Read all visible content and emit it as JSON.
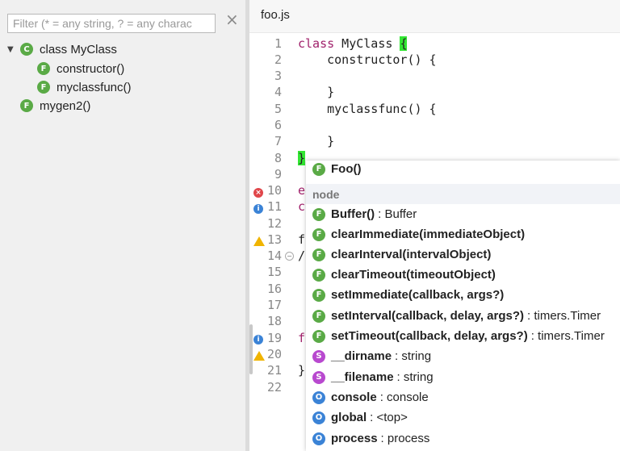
{
  "outline": {
    "filter_placeholder": "Filter (* = any string, ? = any charac",
    "clear_icon": "×",
    "tree": [
      {
        "badge": "C",
        "label": "class MyClass",
        "expanded": true
      },
      {
        "badge": "F",
        "label": "constructor()"
      },
      {
        "badge": "F",
        "label": "myclassfunc()"
      },
      {
        "badge": "F",
        "label": "mygen2()"
      }
    ]
  },
  "editor": {
    "tab": "foo.js",
    "line_numbers": [
      "1",
      "2",
      "3",
      "4",
      "5",
      "6",
      "7",
      "8",
      "9",
      "10",
      "11",
      "12",
      "13",
      "14",
      "15",
      "16",
      "17",
      "18",
      "19",
      "20",
      "21",
      "22"
    ],
    "code": {
      "l1_kw": "class",
      "l1_rest": " MyClass ",
      "l1_brace": "{",
      "l2": "    constructor() {",
      "l4": "    }",
      "l5": "    myclassfunc() {",
      "l7": "    }",
      "l8_brace": "}",
      "l10": "e",
      "l11": "c",
      "l13": "f",
      "l14": "/",
      "l19": "f",
      "l21": "}"
    }
  },
  "autocomplete": {
    "partial_item": {
      "badge": "F",
      "name": "Foo()"
    },
    "header": "node",
    "items": [
      {
        "badge": "F",
        "name": "Buffer()",
        "type": ": Buffer"
      },
      {
        "badge": "F",
        "name": "clearImmediate(immediateObject)",
        "type": ""
      },
      {
        "badge": "F",
        "name": "clearInterval(intervalObject)",
        "type": ""
      },
      {
        "badge": "F",
        "name": "clearTimeout(timeoutObject)",
        "type": ""
      },
      {
        "badge": "F",
        "name": "setImmediate(callback, args?)",
        "type": ""
      },
      {
        "badge": "F",
        "name": "setInterval(callback, delay, args?)",
        "type": ": timers.Timer"
      },
      {
        "badge": "F",
        "name": "setTimeout(callback, delay, args?)",
        "type": ": timers.Timer"
      },
      {
        "badge": "S",
        "name": "__dirname",
        "type": ": string"
      },
      {
        "badge": "S",
        "name": "__filename",
        "type": ": string"
      },
      {
        "badge": "O",
        "name": "console",
        "type": ": console"
      },
      {
        "badge": "O",
        "name": "global",
        "type": ": <top>"
      },
      {
        "badge": "O",
        "name": "process",
        "type": ": process"
      }
    ]
  },
  "colors": {
    "function_badge": "#5aaa46",
    "string_badge": "#b849cf",
    "object_badge": "#3b83d6",
    "keyword": "#a0206a",
    "brace_highlight": "#33e633"
  }
}
